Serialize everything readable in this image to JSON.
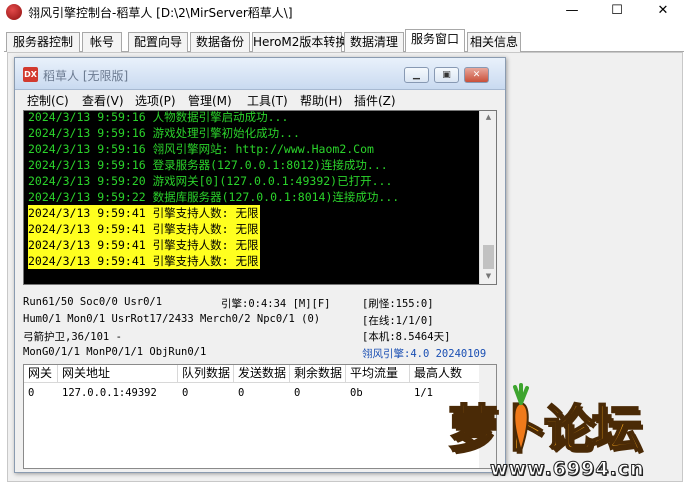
{
  "window": {
    "title": "翎风引擎控制台-稻草人 [D:\\2\\MirServer稻草人\\]",
    "minimize": "—",
    "maximize": "☐",
    "close": "✕"
  },
  "tabs": [
    {
      "label": "服务器控制"
    },
    {
      "label": "帐号"
    },
    {
      "label": "配置向导"
    },
    {
      "label": "数据备份"
    },
    {
      "label": "HeroM2版本转换"
    },
    {
      "label": "数据清理"
    },
    {
      "label": "服务窗口"
    },
    {
      "label": "相关信息"
    }
  ],
  "inner_window": {
    "icon": "DX",
    "title": "稻草人 [无限版]",
    "menu": [
      {
        "label": "控制(C)"
      },
      {
        "label": "查看(V)"
      },
      {
        "label": "选项(P)"
      },
      {
        "label": "管理(M)"
      },
      {
        "label": "工具(T)"
      },
      {
        "label": "帮助(H)"
      },
      {
        "label": "插件(Z)"
      }
    ]
  },
  "log": [
    {
      "text": "2024/3/13 9:59:16 人物数据引擎启动成功...",
      "highlight": false
    },
    {
      "text": "2024/3/13 9:59:16 游戏处理引擎初始化成功...",
      "highlight": false
    },
    {
      "text": "2024/3/13 9:59:16 翎风引擎网站: http://www.Haom2.Com",
      "highlight": false
    },
    {
      "text": "2024/3/13 9:59:16 登录服务器(127.0.0.1:8012)连接成功...",
      "highlight": false
    },
    {
      "text": "2024/3/13 9:59:20 游戏网关[0](127.0.0.1:49392)已打开...",
      "highlight": false
    },
    {
      "text": "2024/3/13 9:59:22 数据库服务器(127.0.0.1:8014)连接成功...",
      "highlight": false
    },
    {
      "text": "2024/3/13 9:59:41 引擎支持人数: 无限",
      "highlight": true
    },
    {
      "text": "2024/3/13 9:59:41 引擎支持人数: 无限",
      "highlight": true
    },
    {
      "text": "2024/3/13 9:59:41 引擎支持人数: 无限",
      "highlight": true
    },
    {
      "text": "2024/3/13 9:59:41 引擎支持人数: 无限",
      "highlight": true
    }
  ],
  "status": {
    "run": "Run61/50 Soc0/0 Usr0/1",
    "engine": "引擎:0:4:34 [M][F]",
    "refresh": "[刷怪:155:0]",
    "hum": "Hum0/1 Mon0/1 UsrRot17/2433 Merch0/2 Npc0/1 (0)",
    "online": "[在线:1/1/0]",
    "archer": "弓箭护卫,36/101 -",
    "local": "[本机:8.5464天]",
    "mong": "MonG0/1/1 MonP0/1/1 ObjRun0/1",
    "version": "翎风引擎:4.0 20240109"
  },
  "gateway_table": {
    "columns": [
      "网关",
      "网关地址",
      "队列数据",
      "发送数据",
      "剩余数据",
      "平均流量",
      "最高人数"
    ],
    "rows": [
      [
        "0",
        "127.0.0.1:49392",
        "0",
        "0",
        "0",
        "0b",
        "1/1"
      ]
    ]
  },
  "watermark": {
    "text": "萝卜论坛",
    "url": "www.6994.cn"
  },
  "colors": {
    "console_bg": "#000000",
    "console_text": "#2bd32b",
    "highlight_bg": "#ffff1f",
    "version_text": "#1a4fb3"
  }
}
